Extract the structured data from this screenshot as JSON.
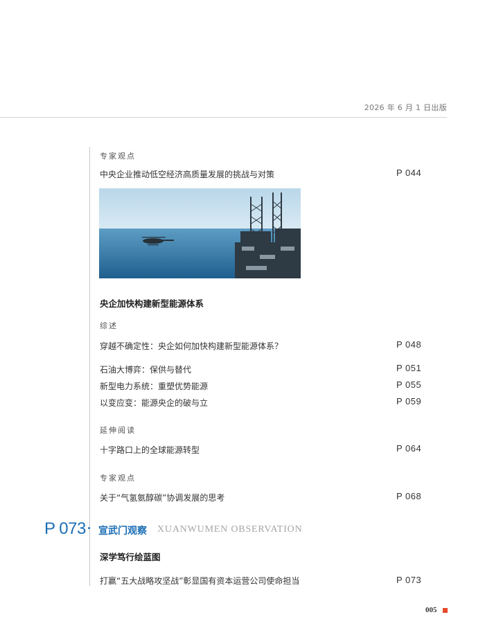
{
  "header": {
    "date": "2026 年 6 月 1 日出版"
  },
  "toc": {
    "cat_expert_1": "专家观点",
    "item_1": {
      "title": "中央企业推动低空经济高质量发展的挑战与对策",
      "page": "P 044"
    },
    "section_energy": "央企加快构建新型能源体系",
    "cat_overview": "综述",
    "item_2": {
      "title": "穿越不确定性：央企如何加快构建新型能源体系？",
      "page": "P 048"
    },
    "item_3": {
      "title": "石油大博弈：保供与替代",
      "page": "P 051"
    },
    "item_4": {
      "title": "新型电力系统：重塑优势能源",
      "page": "P 055"
    },
    "item_5": {
      "title": "以变应变：能源央企的破与立",
      "page": "P 059"
    },
    "cat_extended": "延伸阅读",
    "item_6": {
      "title": "十字路口上的全球能源转型",
      "page": "P 064"
    },
    "cat_expert_2": "专家观点",
    "item_7": {
      "title": "关于“气氢氨醇碳”协调发展的思考",
      "page": "P 068"
    },
    "column": {
      "page": "P 073",
      "dot": "·",
      "title_cn": "宣武门观察",
      "title_en": "XUANWUMEN  OBSERVATION"
    },
    "section_blueprint": "深学笃行绘蓝图",
    "item_8": {
      "title": "打赢“五大战略攻坚战”彰显国有资本运营公司使命担当",
      "page": "P 073"
    }
  },
  "footer": {
    "folio": "005"
  },
  "colors": {
    "accent_blue": "#1b6eb5",
    "folio_mark": "#e8492a",
    "rule_gray": "#c9c9c9"
  }
}
